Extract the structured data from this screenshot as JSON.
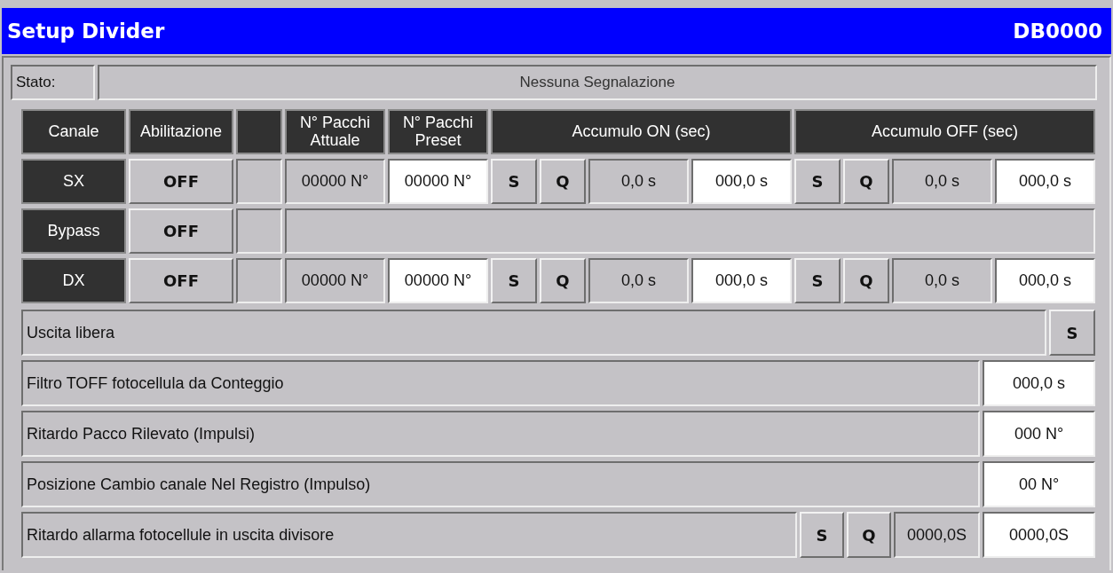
{
  "window": {
    "title": "Setup Divider",
    "code": "DB0000"
  },
  "status": {
    "label": "Stato:",
    "message": "Nessuna Segnalazione"
  },
  "channel_table": {
    "headers": [
      {
        "kind": "text",
        "text": "Canale"
      },
      {
        "kind": "text",
        "text": "Abilitazione"
      },
      {
        "kind": "blank"
      },
      {
        "kind": "text",
        "text": "N° Pacchi Attuale"
      },
      {
        "kind": "text",
        "text": "N° Pacchi Preset"
      },
      {
        "kind": "group",
        "text": "Accumulo ON (sec)"
      },
      {
        "kind": "group",
        "text": "Accumulo OFF (sec)"
      }
    ],
    "rows": [
      {
        "kind": "full",
        "channel": "SX",
        "enable": "OFF",
        "count": "00000 N°",
        "preset": "00000 N°",
        "on": {
          "s": "S",
          "q": "Q",
          "value": "0,0 s",
          "setpoint": "000,0 s"
        },
        "off": {
          "s": "S",
          "q": "Q",
          "value": "0,0 s",
          "setpoint": "000,0 s"
        }
      },
      {
        "kind": "bypass",
        "channel": "Bypass",
        "enable": "OFF"
      },
      {
        "kind": "full",
        "channel": "DX",
        "enable": "OFF",
        "count": "00000 N°",
        "preset": "00000 N°",
        "on": {
          "s": "S",
          "q": "Q",
          "value": "0,0 s",
          "setpoint": "000,0 s"
        },
        "off": {
          "s": "S",
          "q": "Q",
          "value": "0,0 s",
          "setpoint": "000,0 s"
        }
      }
    ]
  },
  "parameters": [
    {
      "kind": "button",
      "label": "Uscita libera",
      "button": "S"
    },
    {
      "kind": "input",
      "label": "Filtro TOFF fotocellula da Conteggio",
      "value": "000,0 s"
    },
    {
      "kind": "input",
      "label": "Ritardo Pacco Rilevato (Impulsi)",
      "value": "000 N°"
    },
    {
      "kind": "input",
      "label": "Posizione Cambio canale Nel Registro (Impulso)",
      "value": "00 N°"
    },
    {
      "kind": "timer",
      "label": "Ritardo allarma fotocellule in uscita divisore",
      "s": "S",
      "q": "Q",
      "value": "0000,0S",
      "setpoint": "0000,0S"
    }
  ]
}
